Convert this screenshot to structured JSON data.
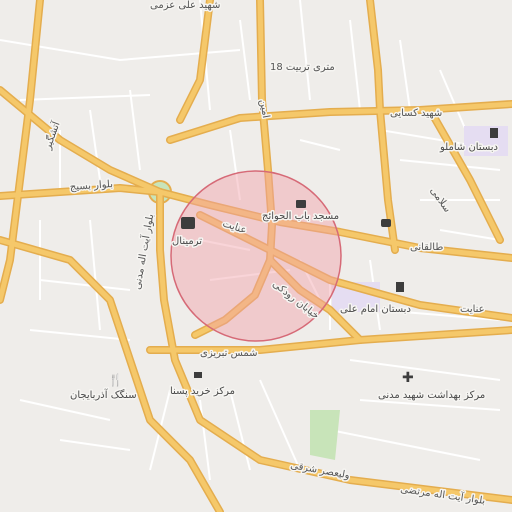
{
  "colors": {
    "background": "#efedea",
    "block_outline": "#ffffff",
    "major_road": "#f5c86a",
    "major_road_casing": "#e4ad4e",
    "park": "#c8e4b9",
    "school": "#e5ddf2",
    "highlight_fill": "#f1a0a8",
    "highlight_stroke": "#d66a77",
    "poi_icon": "#3d3d3d"
  },
  "roads": {
    "north_top": "شهید علی عزمی",
    "tabriz_18m": "18 متری تربیت",
    "kasaei": "شهید کسایی",
    "basij": "بلوار بسیج",
    "ayatollah_madani": "بلوار آیت اله مدنی",
    "enayat_west": "عنایت",
    "enayat_east": "عنایت",
    "taleghani": "طالقانی",
    "roudaki": "خیابان رودکی",
    "shams_tabrizi": "شمس تبریزی",
    "ayatollah_morteza": "بلوار آیت اله مرتضی",
    "valiasr": "ولیعصر شرقی",
    "amin": "امین",
    "atashgir": "آتشگیر",
    "salami": "سلامی"
  },
  "pois": {
    "mosque": {
      "label": "مسجد باب الحوائج",
      "icon": "mosque-icon"
    },
    "terminal": {
      "label": "ترمینال",
      "icon": "bus-icon"
    },
    "school_imam_ali": {
      "label": "دبستان امام علی",
      "icon": "school-icon"
    },
    "school_shamlu": {
      "label": "دبستان شاملو",
      "icon": "school-icon"
    },
    "health_center": {
      "label": "مرکز بهداشت شهید مدنی",
      "icon": "medical-cross-icon"
    },
    "shopping_center": {
      "label": "مرکز خرید پسنا",
      "icon": "cart-icon"
    },
    "stone_cut": {
      "label": "سنگک آذربایجان",
      "icon": "restaurant-icon"
    },
    "car_service": {
      "label": "",
      "icon": "car-icon"
    }
  }
}
